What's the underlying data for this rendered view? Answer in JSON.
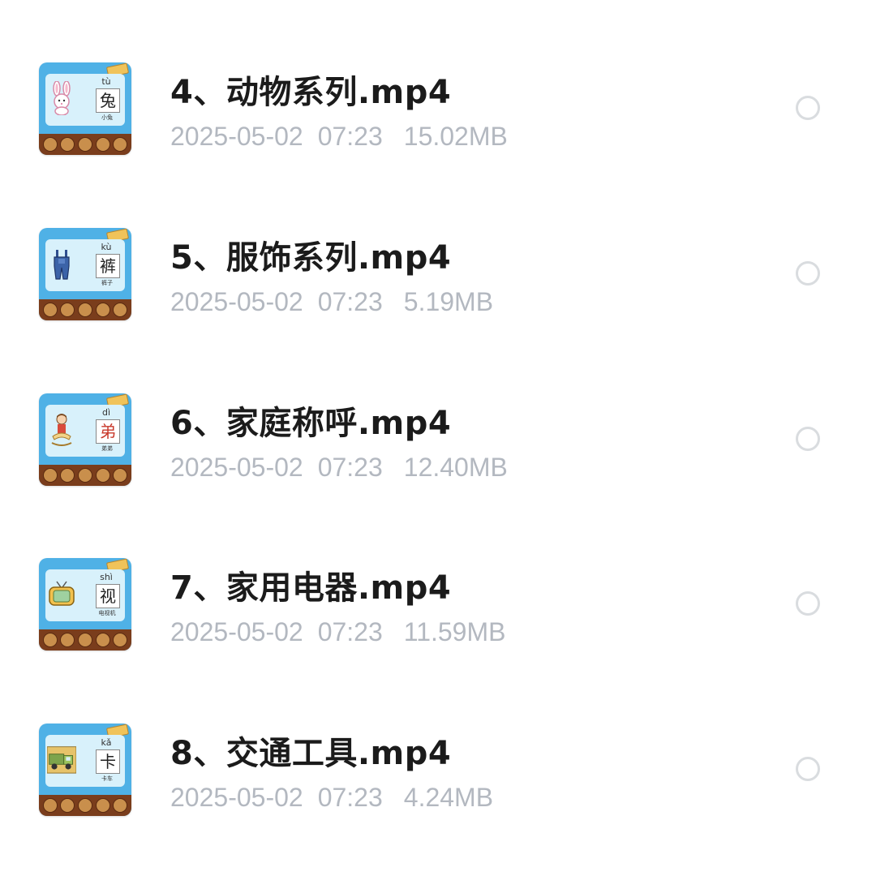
{
  "files": [
    {
      "name": "4、动物系列.mp4",
      "date": "2025-05-02",
      "time": "07:23",
      "size": "15.02MB",
      "thumb": {
        "pinyin": "tù",
        "char": "兔",
        "caption": "小兔",
        "icon": "rabbit-icon"
      }
    },
    {
      "name": "5、服饰系列.mp4",
      "date": "2025-05-02",
      "time": "07:23",
      "size": "5.19MB",
      "thumb": {
        "pinyin": "kù",
        "char": "裤",
        "caption": "裤子",
        "icon": "overalls-icon"
      }
    },
    {
      "name": "6、家庭称呼.mp4",
      "date": "2025-05-02",
      "time": "07:23",
      "size": "12.40MB",
      "thumb": {
        "pinyin": "dì",
        "char": "弟",
        "caption": "弟弟",
        "icon": "boy-on-rocking-horse-icon"
      }
    },
    {
      "name": "7、家用电器.mp4",
      "date": "2025-05-02",
      "time": "07:23",
      "size": "11.59MB",
      "thumb": {
        "pinyin": "shì",
        "char": "视",
        "caption": "电视机",
        "icon": "television-icon"
      }
    },
    {
      "name": "8、交通工具.mp4",
      "date": "2025-05-02",
      "time": "07:23",
      "size": "4.24MB",
      "thumb": {
        "pinyin": "kǎ",
        "char": "卡",
        "caption": "卡车",
        "icon": "truck-icon"
      }
    }
  ],
  "colors": {
    "name": "#1b1b1b",
    "meta": "#b3b8c0",
    "radio_border": "#d9dcdf",
    "thumb_bg": "#4fb1e6",
    "thumb_strip": "#7a3d1c"
  }
}
